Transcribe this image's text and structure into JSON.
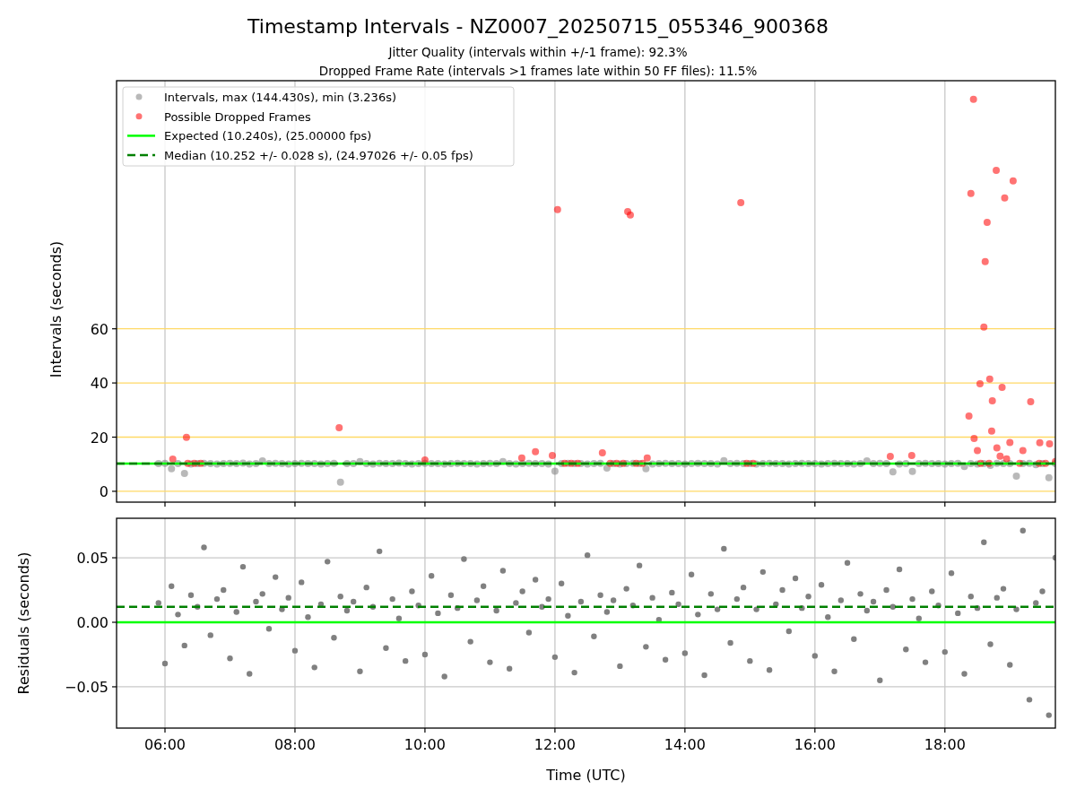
{
  "figure": {
    "title": "Timestamp Intervals - NZ0007_20250715_055346_900368",
    "subtitles": [
      "Jitter Quality (intervals within +/-1 frame): 92.3%",
      "Dropped Frame Rate (intervals >1 frames late within 50 FF files): 11.5%"
    ]
  },
  "charts": [
    {
      "chart_data": {
        "type": "scatter",
        "grid": true,
        "legend": true,
        "ylabel": "Intervals (seconds)",
        "xlim": [
          5.255,
          19.7
        ],
        "ylim": [
          -4.0,
          151.6
        ],
        "yticks": [
          {
            "value": 0,
            "label": "0"
          },
          {
            "value": 20,
            "label": "20"
          },
          {
            "value": 40,
            "label": "40"
          },
          {
            "value": 60,
            "label": "60"
          }
        ],
        "x": [
          5.9,
          6.0,
          6.1,
          6.2,
          6.3,
          6.4,
          6.5,
          6.6,
          6.7,
          6.8,
          6.9,
          7.0,
          7.1,
          7.2,
          7.3,
          7.4,
          7.5,
          7.6,
          7.7,
          7.8,
          7.9,
          8.0,
          8.1,
          8.2,
          8.3,
          8.4,
          8.5,
          8.6,
          8.7,
          8.8,
          8.9,
          9.0,
          9.1,
          9.2,
          9.3,
          9.4,
          9.5,
          9.6,
          9.7,
          9.8,
          9.9,
          10.0,
          10.1,
          10.2,
          10.3,
          10.4,
          10.5,
          10.6,
          10.7,
          10.8,
          10.9,
          11.0,
          11.1,
          11.2,
          11.3,
          11.4,
          11.5,
          11.6,
          11.7,
          11.8,
          11.9,
          12.0,
          12.1,
          12.2,
          12.3,
          12.4,
          12.5,
          12.6,
          12.7,
          12.8,
          12.9,
          13.0,
          13.1,
          13.2,
          13.3,
          13.4,
          13.5,
          13.6,
          13.7,
          13.8,
          13.9,
          14.0,
          14.1,
          14.2,
          14.3,
          14.4,
          14.5,
          14.6,
          14.7,
          14.8,
          14.9,
          15.0,
          15.1,
          15.2,
          15.3,
          15.4,
          15.5,
          15.6,
          15.7,
          15.8,
          15.9,
          16.0,
          16.1,
          16.2,
          16.3,
          16.4,
          16.5,
          16.6,
          16.7,
          16.8,
          16.9,
          17.0,
          17.1,
          17.2,
          17.3,
          17.4,
          17.5,
          17.6,
          17.7,
          17.8,
          17.9,
          18.0,
          18.1,
          18.2,
          18.3,
          18.4,
          18.5,
          18.6,
          18.7,
          18.8,
          18.9,
          19.0,
          19.1,
          19.2,
          19.3,
          19.4,
          19.5,
          19.6,
          19.7
        ],
        "series": [
          {
            "name": "Intervals, max (144.430s), min (3.236s)",
            "type": "scatter",
            "color": "#808080",
            "values": [
              10.2,
              10.3,
              8.3,
              10.2,
              6.6,
              10.1,
              10.2,
              10.3,
              10.2,
              10.1,
              10.2,
              10.3,
              10.2,
              10.4,
              10.1,
              10.2,
              11.2,
              10.2,
              10.3,
              10.2,
              10.1,
              10.2,
              10.3,
              10.2,
              10.2,
              10.1,
              10.2,
              10.3,
              3.4,
              10.2,
              10.2,
              11.0,
              10.2,
              10.1,
              10.3,
              10.2,
              10.2,
              10.4,
              10.2,
              10.1,
              10.2,
              10.3,
              10.2,
              10.2,
              10.1,
              10.2,
              10.3,
              10.2,
              10.2,
              10.1,
              10.2,
              10.3,
              10.2,
              11.0,
              10.2,
              10.1,
              10.2,
              10.3,
              10.2,
              10.2,
              10.1,
              7.4,
              10.2,
              10.3,
              10.2,
              10.2,
              10.1,
              10.2,
              10.3,
              8.6,
              10.2,
              10.1,
              10.2,
              10.3,
              10.2,
              8.3,
              10.1,
              10.2,
              10.3,
              10.2,
              10.2,
              10.1,
              10.2,
              10.3,
              10.2,
              10.2,
              10.1,
              11.3,
              10.2,
              10.3,
              10.2,
              10.2,
              10.1,
              10.2,
              10.3,
              10.2,
              10.2,
              10.1,
              10.2,
              10.3,
              10.2,
              10.2,
              10.1,
              10.2,
              10.3,
              10.2,
              10.2,
              10.1,
              10.2,
              11.2,
              10.2,
              10.3,
              10.2,
              7.2,
              10.1,
              10.2,
              7.3,
              10.2,
              10.3,
              10.2,
              10.2,
              10.1,
              10.2,
              10.3,
              9.2,
              10.2,
              10.1,
              10.2,
              9.6,
              10.3,
              10.2,
              10.2,
              5.6,
              10.2,
              10.3,
              9.8,
              10.2,
              5.0,
              10.2
            ]
          },
          {
            "name": "Possible Dropped Frames",
            "type": "scatter",
            "color": "#ff0000",
            "x": [
              6.12,
              6.33,
              6.35,
              6.45,
              6.55,
              8.68,
              10.0,
              11.49,
              11.7,
              11.96,
              12.04,
              12.15,
              12.25,
              12.35,
              12.73,
              12.85,
              12.95,
              13.05,
              13.12,
              13.16,
              13.25,
              13.35,
              13.42,
              14.86,
              14.95,
              15.05,
              17.16,
              17.49,
              18.37,
              18.4,
              18.44,
              18.45,
              18.5,
              18.55,
              18.54,
              18.68,
              18.6,
              18.62,
              18.65,
              18.69,
              18.72,
              18.73,
              18.79,
              18.8,
              18.85,
              18.88,
              18.92,
              18.95,
              19.0,
              19.05,
              19.15,
              19.2,
              19.32,
              19.45,
              19.46,
              19.55,
              19.61,
              19.7
            ],
            "values": [
              11.9,
              19.9,
              10.3,
              10.3,
              10.3,
              23.5,
              11.6,
              12.3,
              14.6,
              13.2,
              104,
              10.3,
              10.3,
              10.3,
              14.2,
              10.3,
              10.3,
              10.3,
              103.3,
              102,
              10.3,
              10.3,
              12.3,
              106.6,
              10.3,
              10.3,
              12.9,
              13.2,
              27.8,
              110,
              144.7,
              19.5,
              15,
              10.3,
              39.7,
              10.3,
              60.6,
              84.8,
              99.3,
              41.4,
              22.2,
              33.4,
              118.5,
              16,
              13,
              38.4,
              108.3,
              12,
              18,
              114.6,
              10.3,
              15,
              33.1,
              10.3,
              17.9,
              10.3,
              17.5,
              11
            ]
          },
          {
            "name": "Expected (10.240s), (25.00000 fps)",
            "type": "line",
            "color": "#00ff00",
            "x": [
              5.255,
              19.7
            ],
            "values": [
              10.24,
              10.24
            ]
          },
          {
            "name": "Median (10.252 +/- 0.028 s), (24.97026 +/- 0.05 fps)",
            "type": "line",
            "line_style": "dashed",
            "color": "#008000",
            "x": [
              5.255,
              19.7
            ],
            "values": [
              10.252,
              10.252
            ]
          }
        ]
      }
    },
    {
      "chart_data": {
        "type": "scatter",
        "grid": true,
        "xlabel": "Time (UTC)",
        "ylabel": "Residuals (seconds)",
        "xlim": [
          5.255,
          19.7
        ],
        "ylim": [
          -0.082,
          0.0806
        ],
        "xticks": [
          {
            "value": 6,
            "label": "06:00"
          },
          {
            "value": 8,
            "label": "08:00"
          },
          {
            "value": 10,
            "label": "10:00"
          },
          {
            "value": 12,
            "label": "12:00"
          },
          {
            "value": 14,
            "label": "14:00"
          },
          {
            "value": 16,
            "label": "16:00"
          },
          {
            "value": 18,
            "label": "18:00"
          }
        ],
        "yticks": [
          {
            "value": 0.05,
            "label": "0.05"
          },
          {
            "value": 0,
            "label": "0.00"
          },
          {
            "value": -0.05,
            "label": "−0.05"
          }
        ],
        "x": [
          5.9,
          6.0,
          6.1,
          6.2,
          6.3,
          6.4,
          6.5,
          6.6,
          6.7,
          6.8,
          6.9,
          7.0,
          7.1,
          7.2,
          7.3,
          7.4,
          7.5,
          7.6,
          7.7,
          7.8,
          7.9,
          8.0,
          8.1,
          8.2,
          8.3,
          8.4,
          8.5,
          8.6,
          8.7,
          8.8,
          8.9,
          9.0,
          9.1,
          9.2,
          9.3,
          9.4,
          9.5,
          9.6,
          9.7,
          9.8,
          9.9,
          10.0,
          10.1,
          10.2,
          10.3,
          10.4,
          10.5,
          10.6,
          10.7,
          10.8,
          10.9,
          11.0,
          11.1,
          11.2,
          11.3,
          11.4,
          11.5,
          11.6,
          11.7,
          11.8,
          11.9,
          12.0,
          12.1,
          12.2,
          12.3,
          12.4,
          12.5,
          12.6,
          12.7,
          12.8,
          12.9,
          13.0,
          13.1,
          13.2,
          13.3,
          13.4,
          13.5,
          13.6,
          13.7,
          13.8,
          13.9,
          14.0,
          14.1,
          14.2,
          14.3,
          14.4,
          14.5,
          14.6,
          14.7,
          14.8,
          14.9,
          15.0,
          15.1,
          15.2,
          15.3,
          15.4,
          15.5,
          15.6,
          15.7,
          15.8,
          15.9,
          16.0,
          16.1,
          16.2,
          16.3,
          16.4,
          16.5,
          16.6,
          16.7,
          16.8,
          16.9,
          17.0,
          17.1,
          17.2,
          17.3,
          17.4,
          17.5,
          17.6,
          17.7,
          17.8,
          17.9,
          18.0,
          18.1,
          18.2,
          18.3,
          18.4,
          18.5,
          18.6,
          18.7,
          18.8,
          18.9,
          19.0,
          19.1,
          19.2,
          19.3,
          19.4,
          19.5,
          19.6,
          19.7
        ],
        "series": [
          {
            "type": "scatter",
            "color": "#808080",
            "values": [
              0.015,
              -0.032,
              0.028,
              0.006,
              -0.018,
              0.021,
              0.012,
              0.058,
              -0.01,
              0.018,
              0.025,
              -0.028,
              0.008,
              0.043,
              -0.04,
              0.016,
              0.022,
              -0.005,
              0.035,
              0.01,
              0.019,
              -0.022,
              0.031,
              0.004,
              -0.035,
              0.014,
              0.047,
              -0.012,
              0.02,
              0.009,
              0.016,
              -0.038,
              0.027,
              0.012,
              0.055,
              -0.02,
              0.018,
              0.003,
              -0.03,
              0.024,
              0.013,
              -0.025,
              0.036,
              0.007,
              -0.042,
              0.021,
              0.011,
              0.049,
              -0.015,
              0.017,
              0.028,
              -0.031,
              0.009,
              0.04,
              -0.036,
              0.015,
              0.024,
              -0.008,
              0.033,
              0.012,
              0.018,
              -0.027,
              0.03,
              0.005,
              -0.039,
              0.016,
              0.052,
              -0.011,
              0.021,
              0.008,
              0.017,
              -0.034,
              0.026,
              0.013,
              0.044,
              -0.019,
              0.019,
              0.002,
              -0.029,
              0.023,
              0.014,
              -0.024,
              0.037,
              0.006,
              -0.041,
              0.022,
              0.01,
              0.057,
              -0.016,
              0.018,
              0.027,
              -0.03,
              0.01,
              0.039,
              -0.037,
              0.014,
              0.025,
              -0.007,
              0.034,
              0.011,
              0.02,
              -0.026,
              0.029,
              0.004,
              -0.038,
              0.017,
              0.046,
              -0.013,
              0.022,
              0.009,
              0.016,
              -0.045,
              0.025,
              0.012,
              0.041,
              -0.021,
              0.018,
              0.003,
              -0.031,
              0.024,
              0.013,
              -0.023,
              0.038,
              0.007,
              -0.04,
              0.02,
              0.011,
              0.062,
              -0.017,
              0.019,
              0.026,
              -0.033,
              0.01,
              0.071,
              -0.06,
              0.015,
              0.024,
              -0.072,
              0.05
            ]
          },
          {
            "type": "line",
            "color": "#00ff00",
            "x": [
              5.255,
              19.7
            ],
            "values": [
              0,
              0
            ]
          },
          {
            "type": "line",
            "line_style": "dashed",
            "color": "#008000",
            "x": [
              5.255,
              19.7
            ],
            "values": [
              0.012,
              0.012
            ]
          }
        ]
      }
    }
  ]
}
